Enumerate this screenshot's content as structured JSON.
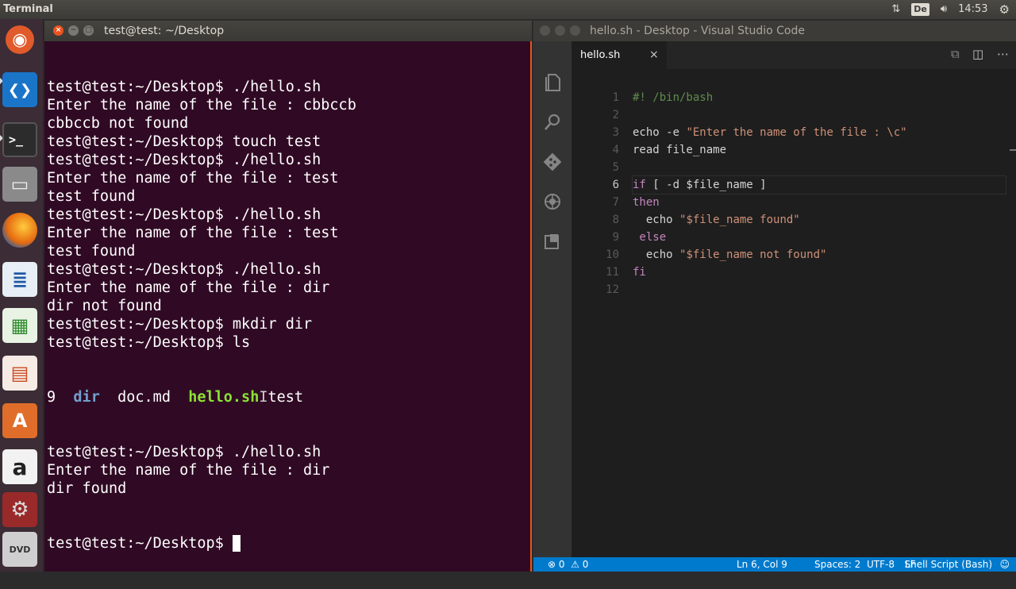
{
  "top_panel": {
    "app_name": "Terminal",
    "keyboard_layout": "De",
    "clock": "14:53",
    "icons": [
      "network-updown-icon",
      "keyboard-layout-icon",
      "volume-icon",
      "clock",
      "settings-gear-icon"
    ]
  },
  "launcher": {
    "items": [
      {
        "name": "ubuntu-dash-icon",
        "symbol": "◉"
      },
      {
        "name": "vscode-icon",
        "symbol": "❮❯"
      },
      {
        "name": "terminal-icon",
        "symbol": ">_"
      },
      {
        "name": "files-icon",
        "symbol": "▭"
      },
      {
        "name": "firefox-icon",
        "symbol": "◔"
      },
      {
        "name": "writer-icon",
        "symbol": "≣"
      },
      {
        "name": "calc-icon",
        "symbol": "▦"
      },
      {
        "name": "impress-icon",
        "symbol": "▤"
      },
      {
        "name": "software-center-icon",
        "symbol": "A"
      },
      {
        "name": "amazon-icon",
        "symbol": "a"
      },
      {
        "name": "system-settings-icon",
        "symbol": "⚙"
      },
      {
        "name": "dvd-icon",
        "symbol": "DVD"
      }
    ]
  },
  "terminal": {
    "title": "test@test: ~/Desktop",
    "lines": [
      "test@test:~/Desktop$ ./hello.sh",
      "Enter the name of the file : cbbccb",
      "cbbccb not found",
      "test@test:~/Desktop$ touch test",
      "test@test:~/Desktop$ ./hello.sh",
      "Enter the name of the file : test",
      "test found",
      "test@test:~/Desktop$ ./hello.sh",
      "Enter the name of the file : test",
      "test found",
      "test@test:~/Desktop$ ./hello.sh",
      "Enter the name of the file : dir",
      "dir not found",
      "test@test:~/Desktop$ mkdir dir",
      "test@test:~/Desktop$ ls"
    ],
    "ls_output": {
      "item1": "9",
      "item2": "dir",
      "item3": "doc.md",
      "item4": "hello.sh",
      "item5": "test"
    },
    "lines_after": [
      "test@test:~/Desktop$ ./hello.sh",
      "Enter the name of the file : dir",
      "dir found"
    ],
    "prompt": "test@test:~/Desktop$ ",
    "colors": {
      "background": "#300a24",
      "dir": "#729fcf",
      "exec": "#8ae234",
      "focus_edge": "#e0581c"
    }
  },
  "vscode": {
    "title": "hello.sh - Desktop - Visual Studio Code",
    "tab_label": "hello.sh",
    "tab_close": "×",
    "line_numbers": [
      "1",
      "2",
      "3",
      "4",
      "5",
      "6",
      "7",
      "8",
      "9",
      "10",
      "11",
      "12"
    ],
    "current_line": 6,
    "code": [
      [
        {
          "t": "#! /bin/bash",
          "c": "comment"
        }
      ],
      [],
      [
        {
          "t": "echo -e ",
          "c": "plain"
        },
        {
          "t": "\"Enter the name of the file : \\c\"",
          "c": "string"
        }
      ],
      [
        {
          "t": "read file_name",
          "c": "plain"
        }
      ],
      [],
      [
        {
          "t": "if",
          "c": "keyword"
        },
        {
          "t": " [ -d $file_name ]",
          "c": "plain"
        }
      ],
      [
        {
          "t": "then",
          "c": "keyword"
        }
      ],
      [
        {
          "t": "  echo ",
          "c": "plain"
        },
        {
          "t": "\"$file_name found\"",
          "c": "string"
        }
      ],
      [
        {
          "t": " else",
          "c": "keyword"
        }
      ],
      [
        {
          "t": "  echo ",
          "c": "plain"
        },
        {
          "t": "\"$file_name not found\"",
          "c": "string"
        }
      ],
      [
        {
          "t": "fi",
          "c": "keyword"
        }
      ],
      []
    ],
    "status": {
      "errors": "0",
      "warnings": "0",
      "position": "Ln 6, Col 9",
      "spaces": "Spaces: 2",
      "encoding": "UTF-8",
      "eol": "LF",
      "language": "Shell Script (Bash)"
    },
    "colors": {
      "status_bar": "#007acc",
      "activity_bar": "#333333",
      "editor": "#1e1e1e"
    }
  }
}
